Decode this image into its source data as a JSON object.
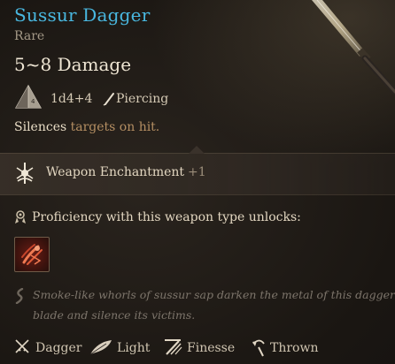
{
  "item": {
    "name": "Sussur Dagger",
    "rarity": "Rare",
    "damage_range": "5~8 Damage",
    "damage_dice": "1d4+4",
    "damage_type": "Piercing",
    "effect_keyword": "Silences",
    "effect_rest": " targets on hit."
  },
  "enchantment": {
    "label": "Weapon Enchantment",
    "bonus": "+1"
  },
  "proficiency": {
    "label": "Proficiency with this weapon type unlocks:"
  },
  "flavor": {
    "line1": "Smoke-like whorls of sussur sap darken the metal of this dagger's",
    "line2": "blade and silence its victims."
  },
  "properties": [
    {
      "label": "Dagger",
      "icon": "crossed-daggers-icon"
    },
    {
      "label": "Light",
      "icon": "feather-icon"
    },
    {
      "label": "Finesse",
      "icon": "finesse-slash-icon"
    },
    {
      "label": "Thrown",
      "icon": "thrown-arc-icon"
    }
  ],
  "colors": {
    "title": "#49b7df",
    "effect_rest": "#b48e62",
    "flavor": "#7d756b",
    "background": "#1a1612"
  }
}
